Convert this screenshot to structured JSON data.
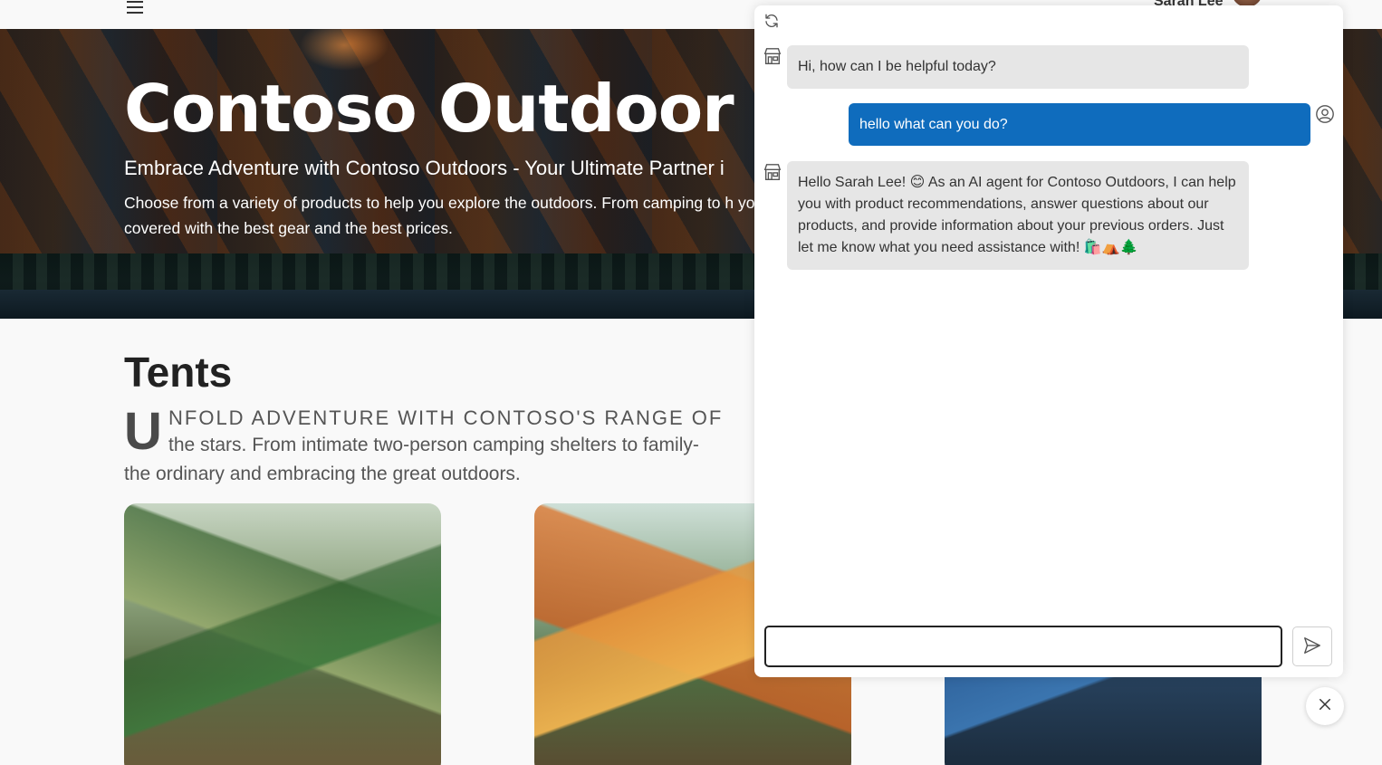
{
  "header": {
    "user_name": "Sarah Lee",
    "menu_icon": "hamburger-menu-icon",
    "avatar_icon": "user-avatar"
  },
  "hero": {
    "title": "Contoso Outdoor Co",
    "subtitle": "Embrace Adventure with Contoso Outdoors - Your Ultimate Partner i",
    "description": "Choose from a variety of products to help you explore the outdoors. From camping to h you covered with the best gear and the best prices."
  },
  "section": {
    "title": "Tents",
    "dropcap": "U",
    "lead": "NFOLD ADVENTURE WITH CONTOSO'S RANGE OF",
    "body_line1": "the stars. From intimate two-person camping shelters to family-",
    "body_line2": "the ordinary and embracing the great outdoors.",
    "cards": [
      "green tent product image",
      "orange tent product image",
      "blue tent product image"
    ]
  },
  "chat": {
    "refresh_icon": "refresh-icon",
    "messages": [
      {
        "role": "bot",
        "text": "Hi, how can I be helpful today?"
      },
      {
        "role": "user",
        "text": "hello what can you do?"
      },
      {
        "role": "bot",
        "text": "Hello Sarah Lee! 😊 As an AI agent for Contoso Outdoors, I can help you with product recommendations, answer questions about our products, and provide information about your previous orders. Just let me know what you need assistance with! 🛍️⛺🌲"
      }
    ],
    "input_value": "",
    "input_placeholder": "",
    "send_icon": "send-icon",
    "close_icon": "close-icon",
    "colors": {
      "user_bubble": "#0f6cbd",
      "bot_bubble": "#e6e6e6"
    }
  }
}
